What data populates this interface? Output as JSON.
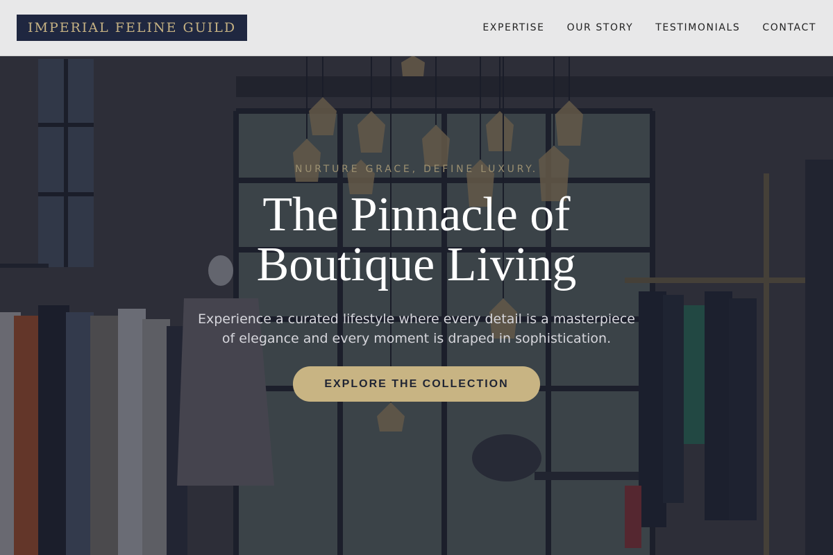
{
  "brand": {
    "name": "IMPERIAL FELINE GUILD"
  },
  "nav": {
    "items": [
      {
        "label": "EXPERTISE"
      },
      {
        "label": "OUR STORY"
      },
      {
        "label": "TESTIMONIALS"
      },
      {
        "label": "CONTACT"
      }
    ]
  },
  "hero": {
    "tagline": "NURTURE GRACE, DEFINE LUXURY.",
    "headline_line1": "The Pinnacle of",
    "headline_line2": "Boutique Living",
    "subtext_line1": "Experience a curated lifestyle where every detail is a masterpiece",
    "subtext_line2": "of elegance and every moment is draped in sophistication.",
    "cta_label": "EXPLORE THE COLLECTION"
  },
  "colors": {
    "accent_gold": "#c8b483",
    "logo_bg": "#1f2740",
    "overlay": "#1c2134"
  }
}
